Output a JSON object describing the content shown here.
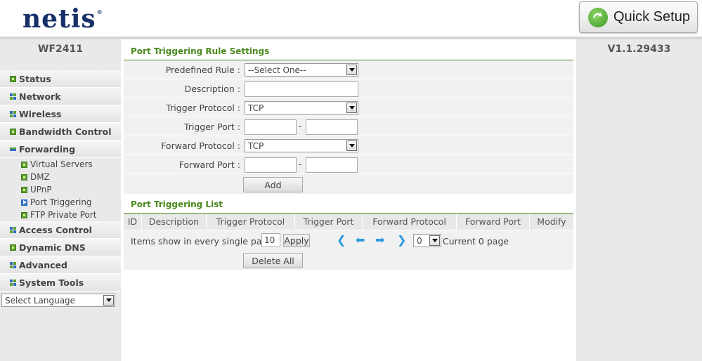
{
  "header": {
    "logo": "netis",
    "logo_mark": "®",
    "quick_setup_label": "Quick Setup"
  },
  "sidebar": {
    "model": "WF2411",
    "menu": [
      {
        "label": "Status",
        "icon": "green"
      },
      {
        "label": "Network",
        "icon": "grid"
      },
      {
        "label": "Wireless",
        "icon": "grid"
      },
      {
        "label": "Bandwidth Control",
        "icon": "green"
      },
      {
        "label": "Forwarding",
        "icon": "dash"
      }
    ],
    "forwarding_sub": [
      "Virtual Servers",
      "DMZ",
      "UPnP",
      "Port Triggering",
      "FTP Private Port"
    ],
    "menu_after": [
      {
        "label": "Access Control",
        "icon": "grid"
      },
      {
        "label": "Dynamic DNS",
        "icon": "green"
      },
      {
        "label": "Advanced",
        "icon": "grid"
      },
      {
        "label": "System Tools",
        "icon": "grid"
      }
    ],
    "language_select": "Select Language"
  },
  "version": "V1.1.29433",
  "settings": {
    "title": "Port Triggering Rule Settings",
    "predefined_rule_label": "Predefined Rule :",
    "predefined_rule_value": "--Select One--",
    "description_label": "Description :",
    "description_value": "",
    "trigger_protocol_label": "Trigger Protocol :",
    "trigger_protocol_value": "TCP",
    "trigger_port_label": "Trigger Port :",
    "trigger_port_from": "",
    "trigger_port_to": "",
    "forward_protocol_label": "Forward Protocol :",
    "forward_protocol_value": "TCP",
    "forward_port_label": "Forward Port :",
    "forward_port_from": "",
    "forward_port_to": "",
    "port_separator": "-",
    "add_button": "Add"
  },
  "list": {
    "title": "Port Triggering List",
    "columns": [
      "ID",
      "Description",
      "Trigger Protocol",
      "Trigger Port",
      "Forward Protocol",
      "Forward Port",
      "Modify"
    ],
    "items_label": "Items show in every single page",
    "items_per_page": "10",
    "apply_button": "Apply",
    "page_value": "0",
    "current_page_text": "Current 0 page",
    "delete_all_button": "Delete All"
  }
}
